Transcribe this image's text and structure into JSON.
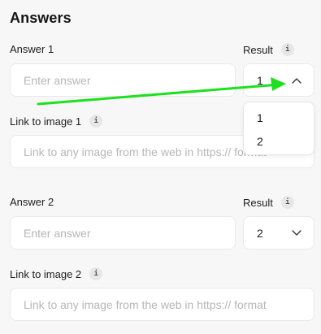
{
  "title": "Answers",
  "answers": [
    {
      "answer_label": "Answer 1",
      "answer_placeholder": "Enter answer",
      "result_label": "Result",
      "result_value": "1",
      "result_open": true,
      "image_label": "Link to image 1",
      "image_placeholder": "Link to any image from the web in https:// format"
    },
    {
      "answer_label": "Answer 2",
      "answer_placeholder": "Enter answer",
      "result_label": "Result",
      "result_value": "2",
      "result_open": false,
      "image_label": "Link to image 2",
      "image_placeholder": "Link to any image from the web in https:// format"
    }
  ],
  "dropdown_options": [
    "1",
    "2"
  ],
  "icons": {
    "info": "i",
    "info_icon": "info-icon",
    "chevron_up": "chevron-up-icon",
    "chevron_down": "chevron-down-icon"
  },
  "colors": {
    "background": "#f7f7f7",
    "field": "#ffffff",
    "border": "#e9e9e9",
    "placeholder": "#b6b6b6",
    "annotation_arrow": "#1ee01e"
  }
}
